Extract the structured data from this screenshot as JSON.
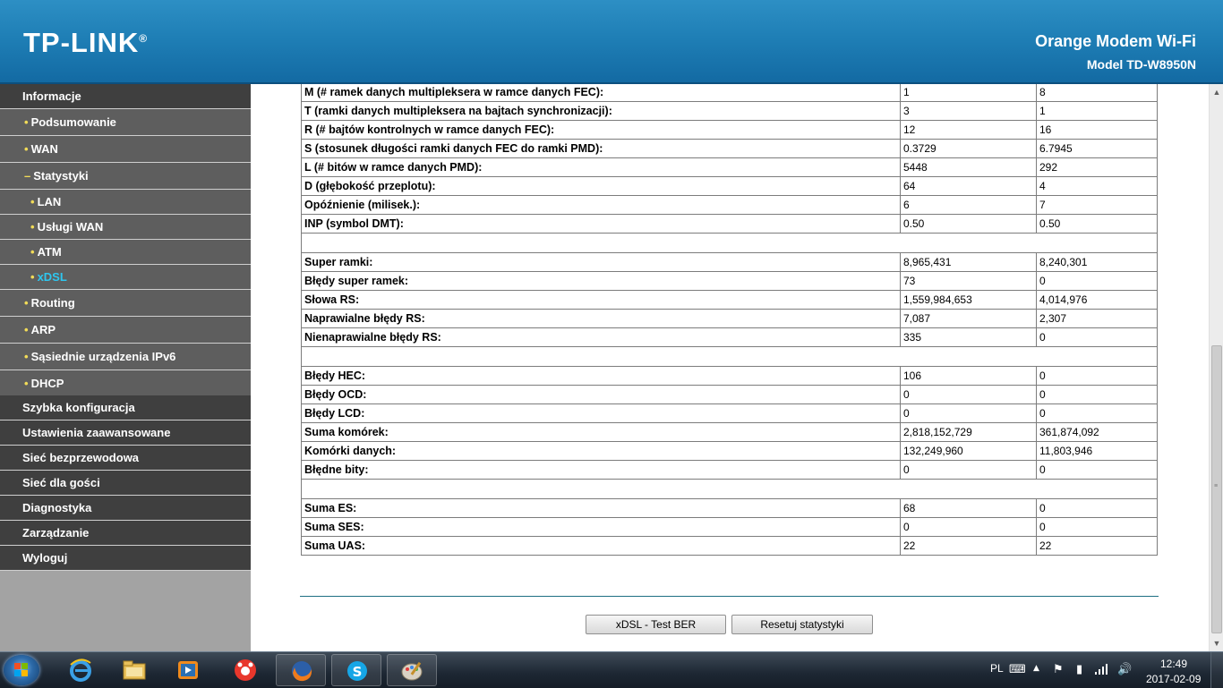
{
  "header": {
    "logo_text": "TP-LINK",
    "logo_mark": "®",
    "product": "Orange Modem Wi-Fi",
    "model": "Model TD-W8950N"
  },
  "sidebar": {
    "items": [
      {
        "label": "Informacje",
        "type": "top"
      },
      {
        "label": "Podsumowanie",
        "type": "sub",
        "bullet": "•"
      },
      {
        "label": "WAN",
        "type": "sub",
        "bullet": "•"
      },
      {
        "label": "Statystyki",
        "type": "sub",
        "bullet": "–"
      },
      {
        "label": "LAN",
        "type": "sub2",
        "bullet": "•"
      },
      {
        "label": "Usługi WAN",
        "type": "sub2",
        "bullet": "•"
      },
      {
        "label": "ATM",
        "type": "sub2",
        "bullet": "•"
      },
      {
        "label": "xDSL",
        "type": "sub2",
        "bullet": "•",
        "active": true
      },
      {
        "label": "Routing",
        "type": "sub",
        "bullet": "•"
      },
      {
        "label": "ARP",
        "type": "sub",
        "bullet": "•"
      },
      {
        "label": "Sąsiednie urządzenia IPv6",
        "type": "sub",
        "bullet": "•"
      },
      {
        "label": "DHCP",
        "type": "sub",
        "bullet": "•"
      },
      {
        "label": "Szybka konfiguracja",
        "type": "top"
      },
      {
        "label": "Ustawienia zaawansowane",
        "type": "top"
      },
      {
        "label": "Sieć bezprzewodowa",
        "type": "top"
      },
      {
        "label": "Sieć dla gości",
        "type": "top"
      },
      {
        "label": "Diagnostyka",
        "type": "top"
      },
      {
        "label": "Zarządzanie",
        "type": "top"
      },
      {
        "label": "Wyloguj",
        "type": "top"
      }
    ],
    "active_color": "#2ec6ef",
    "bullet_color": "#f2dc58"
  },
  "stats": {
    "rows": [
      {
        "label": "M (# ramek danych multipleksera w ramce danych FEC):",
        "down": "1",
        "up": "8"
      },
      {
        "label": "T (ramki danych multipleksera na bajtach synchronizacji):",
        "down": "3",
        "up": "1"
      },
      {
        "label": "R (# bajtów kontrolnych w ramce danych FEC):",
        "down": "12",
        "up": "16"
      },
      {
        "label": "S (stosunek długości ramki danych FEC do ramki PMD):",
        "down": "0.3729",
        "up": "6.7945"
      },
      {
        "label": "L (# bitów w ramce danych PMD):",
        "down": "5448",
        "up": "292"
      },
      {
        "label": "D (głębokość przeplotu):",
        "down": "64",
        "up": "4"
      },
      {
        "label": "Opóźnienie (milisek.):",
        "down": "6",
        "up": "7"
      },
      {
        "label": "INP (symbol DMT):",
        "down": "0.50",
        "up": "0.50"
      },
      {
        "spacer": true
      },
      {
        "label": "Super ramki:",
        "down": "8,965,431",
        "up": "8,240,301"
      },
      {
        "label": "Błędy super ramek:",
        "down": "73",
        "up": "0"
      },
      {
        "label": "Słowa RS:",
        "down": "1,559,984,653",
        "up": "4,014,976"
      },
      {
        "label": "Naprawialne błędy RS:",
        "down": "7,087",
        "up": "2,307"
      },
      {
        "label": "Nienaprawialne błędy RS:",
        "down": "335",
        "up": "0"
      },
      {
        "spacer": true
      },
      {
        "label": "Błędy HEC:",
        "down": "106",
        "up": "0"
      },
      {
        "label": "Błędy OCD:",
        "down": "0",
        "up": "0"
      },
      {
        "label": "Błędy LCD:",
        "down": "0",
        "up": "0"
      },
      {
        "label": "Suma komórek:",
        "down": "2,818,152,729",
        "up": "361,874,092"
      },
      {
        "label": "Komórki danych:",
        "down": "132,249,960",
        "up": "11,803,946"
      },
      {
        "label": "Błędne bity:",
        "down": "0",
        "up": "0"
      },
      {
        "spacer": true
      },
      {
        "label": "Suma ES:",
        "down": "68",
        "up": "0"
      },
      {
        "label": "Suma SES:",
        "down": "0",
        "up": "0"
      },
      {
        "label": "Suma UAS:",
        "down": "22",
        "up": "22"
      }
    ]
  },
  "buttons": {
    "ber_test": "xDSL - Test BER",
    "reset_stats": "Resetuj statystyki"
  },
  "scrollbar": {
    "up_icon": "▲",
    "down_icon": "▼",
    "position": 0.46
  },
  "taskbar": {
    "apps": [
      {
        "name": "internet-explorer-icon",
        "pinned": false
      },
      {
        "name": "file-explorer-icon",
        "pinned": false
      },
      {
        "name": "media-player-icon",
        "pinned": false
      },
      {
        "name": "recorder-icon",
        "pinned": false
      },
      {
        "name": "firefox-icon",
        "pinned": true
      },
      {
        "name": "skype-icon",
        "pinned": true
      },
      {
        "name": "paint-icon",
        "pinned": true
      }
    ],
    "language": "PL",
    "time": "12:49",
    "date": "2017-02-09"
  }
}
